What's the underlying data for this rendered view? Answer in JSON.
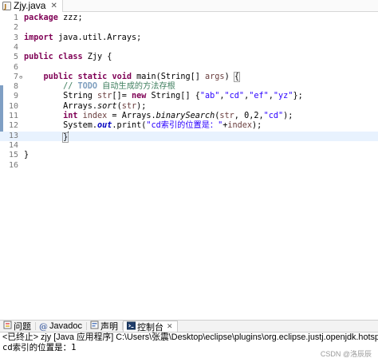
{
  "editor_tab": {
    "label": "Zjy.java",
    "close": "✕"
  },
  "code_lines": [
    {
      "n": "1",
      "html": "<span class='kw'>package</span> zzz;"
    },
    {
      "n": "2",
      "html": ""
    },
    {
      "n": "3",
      "html": "<span class='kw'>import</span> java.util.Arrays;"
    },
    {
      "n": "4",
      "html": ""
    },
    {
      "n": "5",
      "html": "<span class='kw'>public</span> <span class='kw'>class</span> Zjy {"
    },
    {
      "n": "6",
      "html": ""
    },
    {
      "n": "7",
      "html": "    <span class='kw'>public</span> <span class='kw'>static</span> <span class='kw'>void</span> main(String[] <span class='var'>args</span>) <span class='bracket'>{</span>"
    },
    {
      "n": "8",
      "html": "        <span class='cm'>// <span class='todo'>TODO</span> 自动生成的方法存根</span>"
    },
    {
      "n": "9",
      "html": "        String <span class='var'>str</span>[]= <span class='kw'>new</span> String[] {<span class='str'>\"ab\"</span>,<span class='str'>\"cd\"</span>,<span class='str'>\"ef\"</span>,<span class='str'>\"yz\"</span>};"
    },
    {
      "n": "10",
      "html": "        Arrays.<span class='mth'>sort</span>(<span class='var'>str</span>);"
    },
    {
      "n": "11",
      "html": "        <span class='kw'>int</span> <span class='var'>index</span> = Arrays.<span class='mth'>binarySearch</span>(<span class='var'>str</span>, 0,2,<span class='str'>\"cd\"</span>);"
    },
    {
      "n": "12",
      "html": "        System.<span class='fld'>out</span>.print(<span class='str'>\"cd索引的位置是：\"</span>+<span class='var'>index</span>);"
    },
    {
      "n": "13",
      "html": "        <span class='bracket'>}</span><span class='cursor'></span>"
    },
    {
      "n": "14",
      "html": ""
    },
    {
      "n": "15",
      "html": "}"
    },
    {
      "n": "16",
      "html": ""
    }
  ],
  "console_tabs": [
    {
      "label": "问题",
      "icon": "problems-icon"
    },
    {
      "label": "Javadoc",
      "icon": "javadoc-icon"
    },
    {
      "label": "声明",
      "icon": "declaration-icon"
    },
    {
      "label": "控制台",
      "icon": "console-icon",
      "active": true
    }
  ],
  "console_close": "✕",
  "console_status": "<已终止> zjy [Java 应用程序] C:\\Users\\张震\\Desktop\\eclipse\\plugins\\org.eclipse.justj.openjdk.hotspot.jre.full.win",
  "console_output": "cd索引的位置是：1",
  "watermark": "CSDN @洛辰辰"
}
